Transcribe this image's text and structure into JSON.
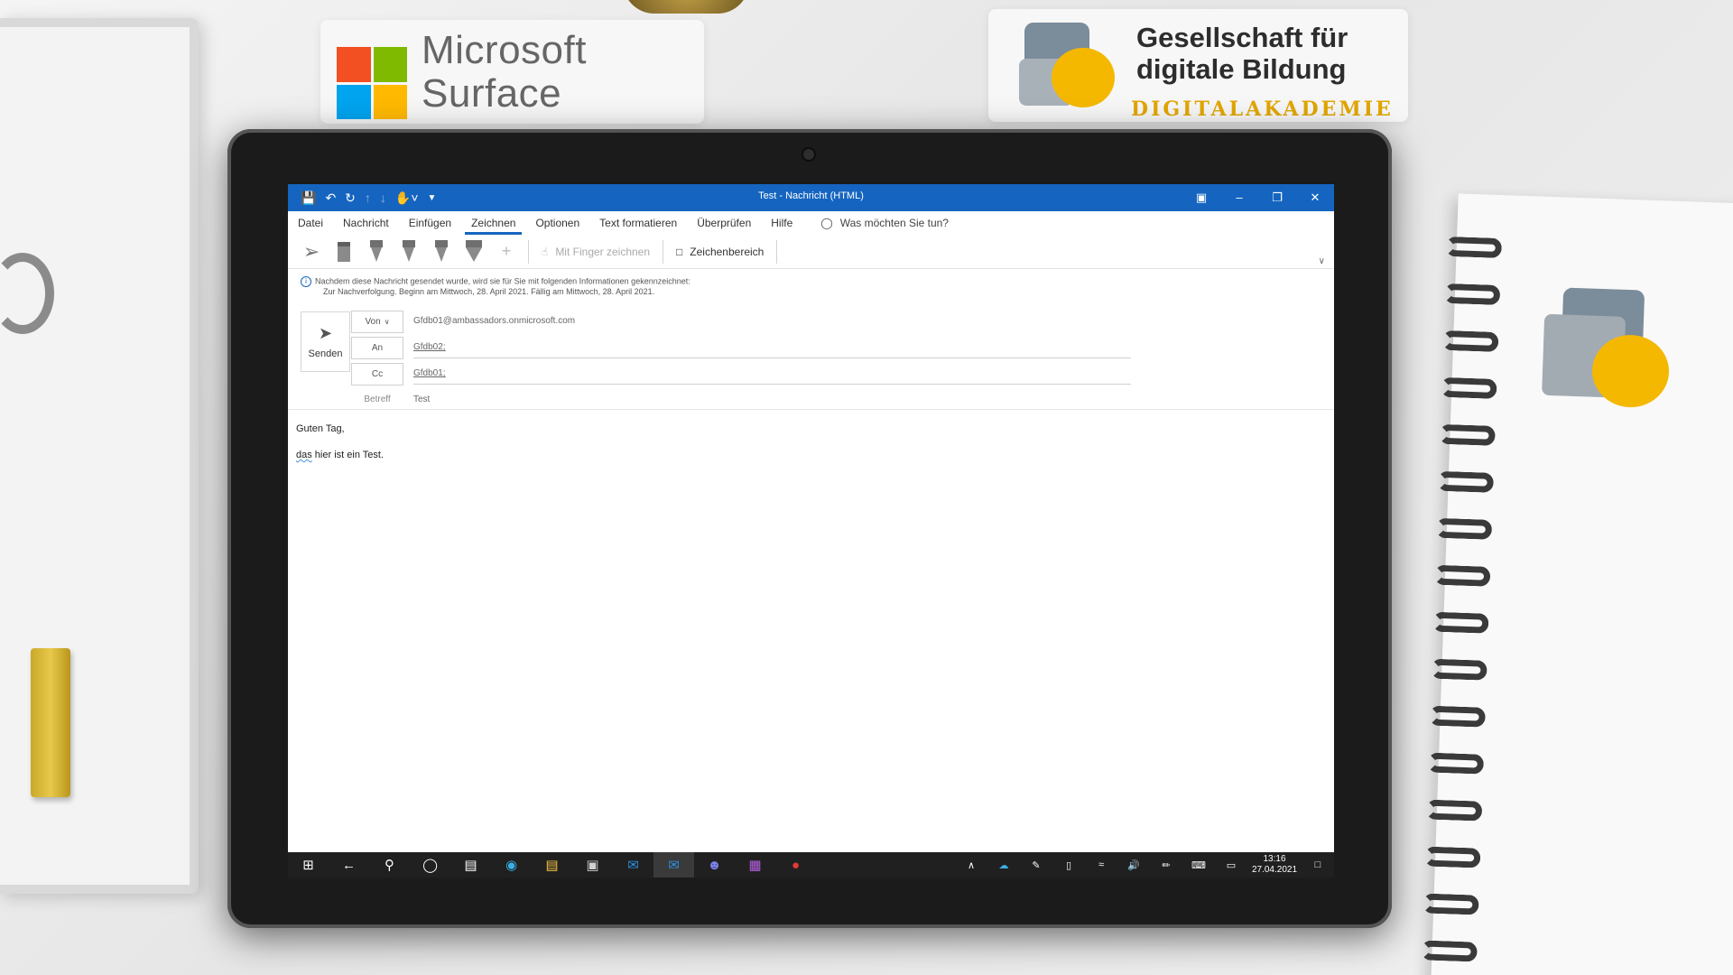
{
  "branding": {
    "microsoft_text_1": "Microsoft",
    "microsoft_text_2": "Surface",
    "gfdb_line_1": "Gesellschaft für",
    "gfdb_line_2": "digitale Bildung",
    "gfdb_sub": "DIGITALAKADEMIE"
  },
  "window": {
    "title": "Test  -  Nachricht (HTML)",
    "quick_access": [
      "save-icon",
      "undo-icon",
      "redo-icon",
      "up-icon",
      "down-icon",
      "touch-mode-icon",
      "customize-icon"
    ]
  },
  "menu": {
    "items": [
      "Datei",
      "Nachricht",
      "Einfügen",
      "Zeichnen",
      "Optionen",
      "Text formatieren",
      "Überprüfen",
      "Hilfe"
    ],
    "active": "Zeichnen",
    "tell_me": "Was möchten Sie tun?"
  },
  "ribbon": {
    "finger_draw": "Mit Finger zeichnen",
    "drawing_canvas": "Zeichenbereich"
  },
  "info": {
    "line1": "Nachdem diese Nachricht gesendet wurde, wird sie für Sie mit folgenden Informationen gekennzeichnet:",
    "line2": "Zur Nachverfolgung.  Beginn am Mittwoch, 28. April 2021.  Fällig am Mittwoch, 28. April 2021."
  },
  "compose": {
    "send_label": "Senden",
    "from_label": "Von",
    "from_value": "Gfdb01@ambassadors.onmicrosoft.com",
    "to_label": "An",
    "to_value": "Gfdb02;",
    "cc_label": "Cc",
    "cc_value": "Gfdb01;",
    "subject_label": "Betreff",
    "subject_value": "Test",
    "body_greeting": "Guten Tag,",
    "body_line_word": "das",
    "body_line_rest": " hier ist ein Test."
  },
  "taskbar": {
    "time": "13:16",
    "date": "27.04.2021"
  },
  "colors": {
    "accent": "#1565c0",
    "taskbar": "#202020"
  }
}
